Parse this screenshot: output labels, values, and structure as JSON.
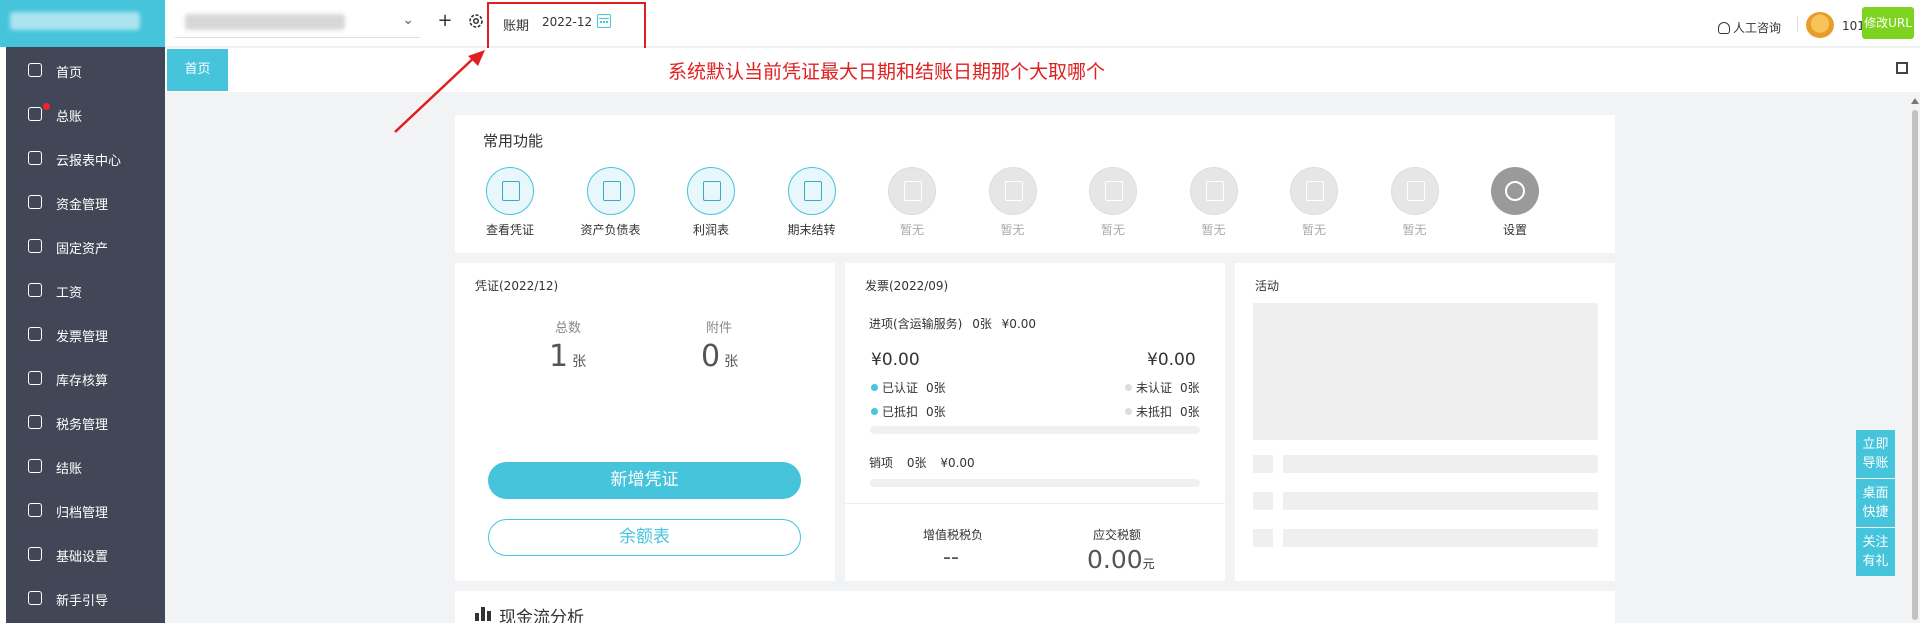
{
  "header": {
    "period_label": "账期",
    "period_value": "2022-12",
    "consult_label": "人工咨询",
    "user_number": "101",
    "modify_url_label": "修改URL"
  },
  "annotation": {
    "text": "系统默认当前凭证最大日期和结账日期那个大取哪个",
    "color": "#e02020"
  },
  "sidebar": {
    "items": [
      {
        "label": "首页",
        "icon": "home-icon"
      },
      {
        "label": "总账",
        "icon": "ledger-icon"
      },
      {
        "label": "云报表中心",
        "icon": "chart-icon"
      },
      {
        "label": "资金管理",
        "icon": "money-icon"
      },
      {
        "label": "固定资产",
        "icon": "asset-icon"
      },
      {
        "label": "工资",
        "icon": "salary-icon"
      },
      {
        "label": "发票管理",
        "icon": "invoice-icon"
      },
      {
        "label": "库存核算",
        "icon": "warehouse-icon"
      },
      {
        "label": "税务管理",
        "icon": "tax-icon"
      },
      {
        "label": "结账",
        "icon": "close-account-icon"
      },
      {
        "label": "归档管理",
        "icon": "archive-icon"
      },
      {
        "label": "基础设置",
        "icon": "settings-icon"
      },
      {
        "label": "新手引导",
        "icon": "guide-icon"
      }
    ]
  },
  "tabs": {
    "home": "首页"
  },
  "common_functions": {
    "title": "常用功能",
    "items": [
      {
        "label": "查看凭证",
        "icon": "voucher-search-icon",
        "enabled": true
      },
      {
        "label": "资产负债表",
        "icon": "balance-sheet-icon",
        "enabled": true
      },
      {
        "label": "利润表",
        "icon": "profit-icon",
        "enabled": true
      },
      {
        "label": "期末结转",
        "icon": "carryover-icon",
        "enabled": true
      },
      {
        "label": "暂无",
        "icon": "empty-icon",
        "enabled": false
      },
      {
        "label": "暂无",
        "icon": "empty-icon",
        "enabled": false
      },
      {
        "label": "暂无",
        "icon": "empty-icon",
        "enabled": false
      },
      {
        "label": "暂无",
        "icon": "empty-icon",
        "enabled": false
      },
      {
        "label": "暂无",
        "icon": "empty-icon",
        "enabled": false
      },
      {
        "label": "暂无",
        "icon": "empty-icon",
        "enabled": false
      },
      {
        "label": "设置",
        "icon": "gear-icon",
        "enabled": true
      }
    ]
  },
  "voucher": {
    "title": "凭证(2022/12)",
    "total_label": "总数",
    "total_value": "1",
    "total_unit": "张",
    "attach_label": "附件",
    "attach_value": "0",
    "attach_unit": "张",
    "new_voucher_button": "新增凭证",
    "balance_button": "余额表"
  },
  "invoice": {
    "title": "发票(2022/09)",
    "input_label": "进项(含运输服务)",
    "input_count": "0张",
    "input_amount": "¥0.00",
    "left_amount": "¥0.00",
    "right_amount": "¥0.00",
    "certified_label": "已认证",
    "certified_value": "0张",
    "uncertified_label": "未认证",
    "uncertified_value": "0张",
    "deducted_label": "已抵扣",
    "deducted_value": "0张",
    "undeducted_label": "未抵扣",
    "undeducted_value": "0张",
    "output_label": "销项",
    "output_count": "0张",
    "output_amount": "¥0.00",
    "vat_burden_label": "增值税税负",
    "vat_burden_value": "--",
    "tax_payable_label": "应交税额",
    "tax_payable_value": "0.00",
    "tax_payable_unit": "元"
  },
  "activity": {
    "title": "活动"
  },
  "cashflow": {
    "title": "现金流分析"
  },
  "floating": {
    "btn1": [
      "立即",
      "导账"
    ],
    "btn2": [
      "桌面",
      "快捷"
    ],
    "btn3": [
      "关注",
      "有礼"
    ]
  },
  "colors": {
    "accent": "#45c4dc",
    "sidebar": "#414756",
    "alert": "#e02020",
    "modify_url": "#7ed321"
  }
}
